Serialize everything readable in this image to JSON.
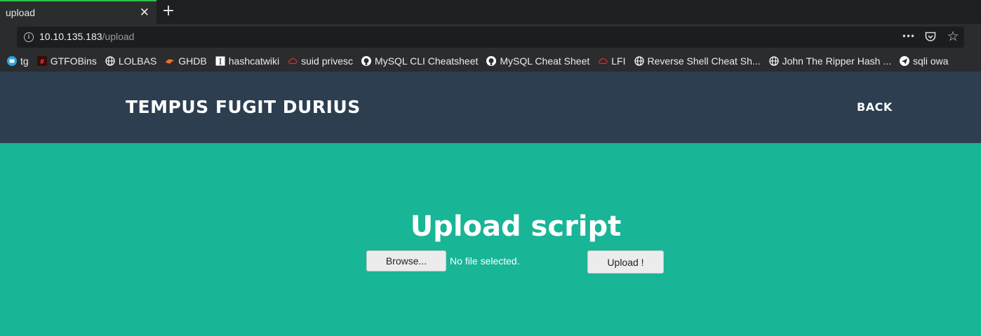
{
  "browser": {
    "tab": {
      "title": "upload",
      "close_glyph": "✕"
    },
    "new_tab_glyph": "+",
    "url": {
      "host": "10.10.135.183",
      "path": "/upload"
    },
    "url_actions": [
      {
        "icon": "more-icon",
        "glyph": "•••"
      },
      {
        "icon": "pocket-icon",
        "glyph": ""
      },
      {
        "icon": "bookmark-star-icon",
        "glyph": "☆"
      }
    ],
    "bookmarks": [
      {
        "label": "tg",
        "icon": "telegram-icon",
        "color": "#2aa3e3"
      },
      {
        "label": "GTFOBins",
        "icon": "gtfobins-icon",
        "color": "#c0392b"
      },
      {
        "label": "LOLBAS",
        "icon": "globe-icon",
        "color": "#ffffff"
      },
      {
        "label": "GHDB",
        "icon": "ghdb-icon",
        "color": "#e8702a"
      },
      {
        "label": "hashcatwiki",
        "icon": "wiki-icon",
        "color": "#ffffff"
      },
      {
        "label": "suid privesc",
        "icon": "cloud-icon",
        "color": "#d32f2f"
      },
      {
        "label": "MySQL CLI Cheatsheet",
        "icon": "github-icon",
        "color": "#ffffff"
      },
      {
        "label": "MySQL Cheat Sheet",
        "icon": "github-icon",
        "color": "#ffffff"
      },
      {
        "label": "LFI",
        "icon": "cloud-icon",
        "color": "#d32f2f"
      },
      {
        "label": "Reverse Shell Cheat Sh...",
        "icon": "globe-icon",
        "color": "#ffffff"
      },
      {
        "label": "John The Ripper Hash ...",
        "icon": "globe-icon",
        "color": "#ffffff"
      },
      {
        "label": "sqli owa",
        "icon": "send-icon",
        "color": "#ffffff"
      }
    ]
  },
  "page": {
    "brand": "TEMPUS FUGIT DURIUS",
    "back_label": "BACK",
    "title": "Upload script",
    "browse_label": "Browse...",
    "file_status": "No file selected.",
    "upload_label": "Upload !",
    "colors": {
      "header_bg": "#2c3e50",
      "main_bg": "#18b596"
    }
  }
}
